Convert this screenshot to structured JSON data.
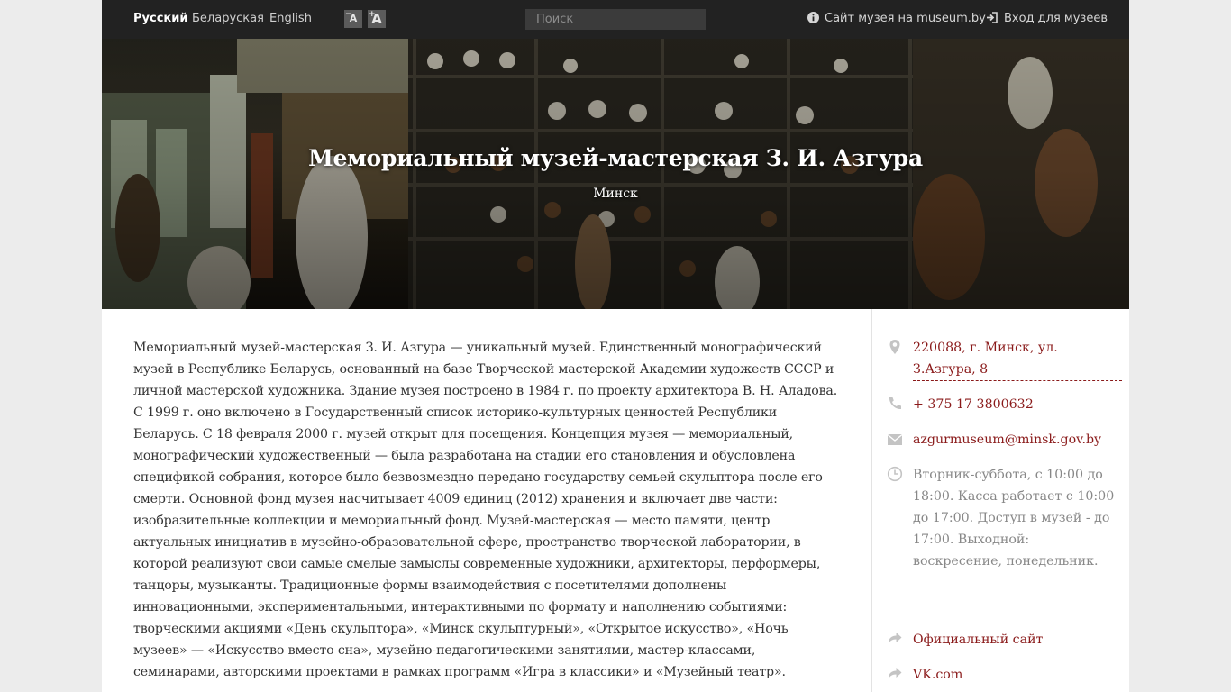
{
  "topbar": {
    "languages": [
      "Русский",
      "Беларуская",
      "English"
    ],
    "font_decrease": "A",
    "font_increase": "A",
    "search_placeholder": "Поиск",
    "museum_site_link": "Сайт музея на museum.by",
    "login_link": "Вход для музеев"
  },
  "hero": {
    "title": "Мемориальный музей-мастерская З. И. Азгура",
    "city": "Минск"
  },
  "description": "Мемориальный музей-мастерская З. И. Азгура — уникальный музей. Единственный монографический музей в Республике Беларусь, основанный на базе Творческой мастерской Академии художеств СССР и личной мастерской художника. Здание музея построено в 1984 г. по проекту архитектора В. Н. Аладова. С 1999 г. оно включено в Государственный список историко-культурных ценностей Республики Беларусь. С 18 февраля 2000 г. музей открыт для посещения. Концепция музея — мемориальный, монографический художественный — была разработана на стадии его становления и обусловлена спецификой собрания, которое было безвозмездно передано государству семьей скульптора после его смерти. Основной фонд музея насчитывает 4009 единиц (2012) хранения и включает две части: изобразительные коллекции и мемориальный фонд. Музей-мастерская — место памяти, центр актуальных инициатив в музейно-образовательной сфере, пространство творческой лаборатории, в которой реализуют свои самые смелые замыслы современные художники, архитекторы, перформеры, танцоры, музыканты. Традиционные формы взаимодействия с посетителями дополнены инновационными, экспериментальными, интерактивными по формату и наполнению событиями: творческими акциями «День скульптора», «Минск скульптурный», «Открытое искусство», «Ночь музеев» — «Искусство вместо сна», музейно-педагогическими занятиями, мастер-классами, семинарами, авторскими проектами в рамках программ «Игра в классики» и «Музейный театр».",
  "sidebar": {
    "address": "220088, г. Минск, ул. З.Азгура, 8",
    "phone": "+ 375 17 3800632",
    "email": "azgurmuseum@minsk.gov.by",
    "hours": "Вторник-суббота, с 10:00 до 18:00. Касса работает с 10:00 до 17:00. Доступ в музей - до 17:00. Выходной: воскресение, понедельник.",
    "official_site": "Официальный сайт",
    "vk": "VK.com"
  },
  "icons": [
    "info-icon",
    "login-icon",
    "location-pin-icon",
    "phone-icon",
    "envelope-icon",
    "clock-icon",
    "share-arrow-icon"
  ],
  "colors": {
    "topbar": "#222222",
    "link": "#8a1a1a",
    "muted_text": "#888888",
    "body_text": "#333333"
  }
}
